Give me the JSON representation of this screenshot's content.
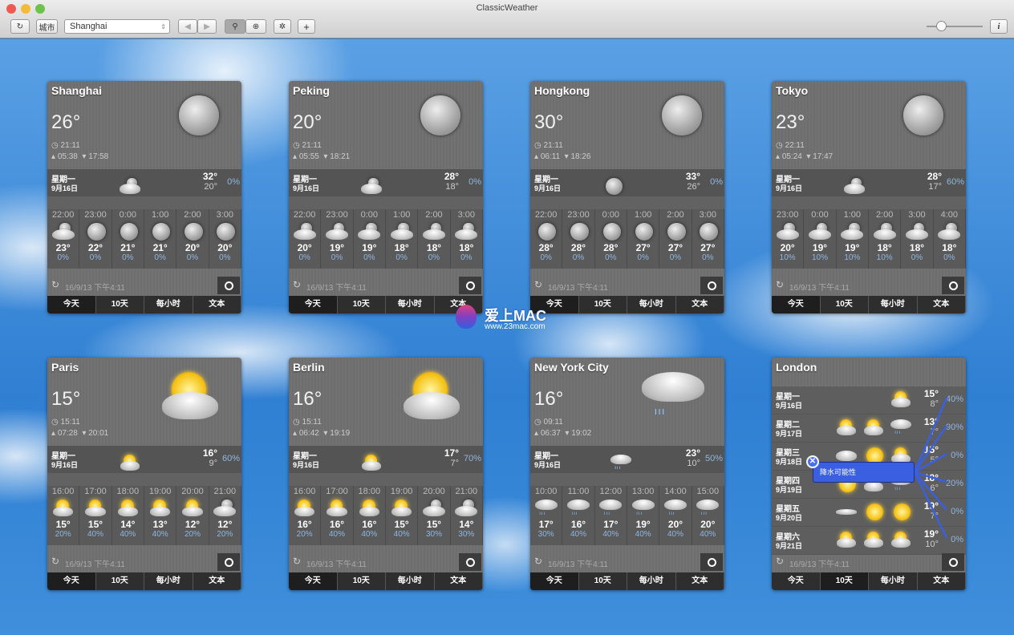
{
  "window": {
    "title": "ClassicWeather"
  },
  "toolbar": {
    "refresh_icon": "↻",
    "city_label": "城市",
    "city_value": "Shanghai",
    "prev": "◀",
    "next": "▶",
    "zoom_out": "⚲",
    "zoom_in": "⊕",
    "settings": "✲",
    "add": "+",
    "info": "i",
    "zoom_slider": 0.25
  },
  "tabs": [
    "今天",
    "10天",
    "每小时",
    "文本"
  ],
  "updated": "16/9/13 下午4:11",
  "cards": [
    {
      "name": "Shanghai",
      "temp": "26°",
      "time": "21:11",
      "sunrise": "05:38",
      "sunset": "17:58",
      "icon": "moon",
      "today": {
        "day": "星期一",
        "date": "9月16日",
        "icon": "cloud-moon",
        "hi": "32°",
        "lo": "20°",
        "precip": "0%"
      },
      "hours": [
        [
          "22:00",
          "cloud-moon",
          "23°",
          "0%"
        ],
        [
          "23:00",
          "moon",
          "22°",
          "0%"
        ],
        [
          "0:00",
          "moon",
          "21°",
          "0%"
        ],
        [
          "1:00",
          "moon",
          "21°",
          "0%"
        ],
        [
          "2:00",
          "moon",
          "20°",
          "0%"
        ],
        [
          "3:00",
          "moon",
          "20°",
          "0%"
        ]
      ]
    },
    {
      "name": "Peking",
      "temp": "20°",
      "time": "21:11",
      "sunrise": "05:55",
      "sunset": "18:21",
      "icon": "moon",
      "today": {
        "day": "星期一",
        "date": "9月16日",
        "icon": "cloud-moon",
        "hi": "28°",
        "lo": "18°",
        "precip": "0%"
      },
      "hours": [
        [
          "22:00",
          "cloud-moon",
          "20°",
          "0%"
        ],
        [
          "23:00",
          "cloud-moon",
          "19°",
          "0%"
        ],
        [
          "0:00",
          "cloud-moon",
          "19°",
          "0%"
        ],
        [
          "1:00",
          "cloud-moon",
          "18°",
          "0%"
        ],
        [
          "2:00",
          "cloud-moon",
          "18°",
          "0%"
        ],
        [
          "3:00",
          "cloud-moon",
          "18°",
          "0%"
        ]
      ]
    },
    {
      "name": "Hongkong",
      "temp": "30°",
      "time": "21:11",
      "sunrise": "06:11",
      "sunset": "18:26",
      "icon": "moon",
      "today": {
        "day": "星期一",
        "date": "9月16日",
        "icon": "moon",
        "hi": "33°",
        "lo": "26°",
        "precip": "0%"
      },
      "hours": [
        [
          "22:00",
          "moon",
          "28°",
          "0%"
        ],
        [
          "23:00",
          "moon",
          "28°",
          "0%"
        ],
        [
          "0:00",
          "moon",
          "28°",
          "0%"
        ],
        [
          "1:00",
          "moon",
          "27°",
          "0%"
        ],
        [
          "2:00",
          "moon",
          "27°",
          "0%"
        ],
        [
          "3:00",
          "moon",
          "27°",
          "0%"
        ]
      ]
    },
    {
      "name": "Tokyo",
      "temp": "23°",
      "time": "22:11",
      "sunrise": "05:24",
      "sunset": "17:47",
      "icon": "moon",
      "today": {
        "day": "星期一",
        "date": "9月16日",
        "icon": "cloud-moon",
        "hi": "28°",
        "lo": "17°",
        "precip": "60%"
      },
      "hours": [
        [
          "23:00",
          "cloud-moon",
          "20°",
          "10%"
        ],
        [
          "0:00",
          "cloud-moon",
          "19°",
          "10%"
        ],
        [
          "1:00",
          "cloud-moon",
          "19°",
          "10%"
        ],
        [
          "2:00",
          "cloud-moon",
          "18°",
          "10%"
        ],
        [
          "3:00",
          "cloud-moon",
          "18°",
          "0%"
        ],
        [
          "4:00",
          "cloud-moon",
          "18°",
          "0%"
        ]
      ]
    },
    {
      "name": "Paris",
      "temp": "15°",
      "time": "15:11",
      "sunrise": "07:28",
      "sunset": "20:01",
      "icon": "cloud-sun",
      "today": {
        "day": "星期一",
        "date": "9月16日",
        "icon": "cloud-sun",
        "hi": "16°",
        "lo": "9°",
        "precip": "60%"
      },
      "hours": [
        [
          "16:00",
          "cloud-sun",
          "15°",
          "20%"
        ],
        [
          "17:00",
          "cloud-sun",
          "15°",
          "40%"
        ],
        [
          "18:00",
          "cloud-sun",
          "14°",
          "40%"
        ],
        [
          "19:00",
          "cloud-sun",
          "13°",
          "40%"
        ],
        [
          "20:00",
          "cloud-sun",
          "12°",
          "20%"
        ],
        [
          "21:00",
          "cloud-moon",
          "12°",
          "20%"
        ]
      ]
    },
    {
      "name": "Berlin",
      "temp": "16°",
      "time": "15:11",
      "sunrise": "06:42",
      "sunset": "19:19",
      "icon": "cloud-sun",
      "today": {
        "day": "星期一",
        "date": "9月16日",
        "icon": "cloud-sun",
        "hi": "17°",
        "lo": "7°",
        "precip": "70%"
      },
      "hours": [
        [
          "16:00",
          "cloud-sun",
          "16°",
          "20%"
        ],
        [
          "17:00",
          "cloud-sun",
          "16°",
          "40%"
        ],
        [
          "18:00",
          "cloud-sun",
          "16°",
          "40%"
        ],
        [
          "19:00",
          "cloud-sun",
          "15°",
          "40%"
        ],
        [
          "20:00",
          "cloud-moon",
          "15°",
          "30%"
        ],
        [
          "21:00",
          "cloud-moon",
          "14°",
          "30%"
        ]
      ]
    },
    {
      "name": "New York City",
      "temp": "16°",
      "time": "09:11",
      "sunrise": "06:37",
      "sunset": "19:02",
      "icon": "rain",
      "today": {
        "day": "星期一",
        "date": "9月16日",
        "icon": "rain",
        "hi": "23°",
        "lo": "10°",
        "precip": "50%"
      },
      "hours": [
        [
          "10:00",
          "rain",
          "17°",
          "30%"
        ],
        [
          "11:00",
          "rain",
          "16°",
          "40%"
        ],
        [
          "12:00",
          "rain",
          "17°",
          "40%"
        ],
        [
          "13:00",
          "rain",
          "19°",
          "40%"
        ],
        [
          "14:00",
          "rain",
          "20°",
          "40%"
        ],
        [
          "15:00",
          "rain",
          "20°",
          "40%"
        ]
      ]
    }
  ],
  "london": {
    "name": "London",
    "tooltip": "降水可能性",
    "close": "✕",
    "days": [
      {
        "day": "星期一",
        "date": "9月16日",
        "icons": [
          "cloud-sun"
        ],
        "hi": "15°",
        "lo": "8°",
        "precip": "40%"
      },
      {
        "day": "星期二",
        "date": "9月17日",
        "icons": [
          "cloud-sun",
          "cloud-sun",
          "rain"
        ],
        "hi": "13°",
        "lo": "7°",
        "precip": "90%"
      },
      {
        "day": "星期三",
        "date": "9月18日",
        "icons": [
          "cloud",
          "sun",
          "cloud-sun"
        ],
        "hi": "15°",
        "lo": "5°",
        "precip": "0%"
      },
      {
        "day": "星期四",
        "date": "9月19日",
        "icons": [
          "sun",
          "cloud-sun",
          "rain"
        ],
        "hi": "18°",
        "lo": "6°",
        "precip": "20%"
      },
      {
        "day": "星期五",
        "date": "9月20日",
        "icons": [
          "fog",
          "sun",
          "sun"
        ],
        "hi": "19°",
        "lo": "7°",
        "precip": "0%"
      },
      {
        "day": "星期六",
        "date": "9月21日",
        "icons": [
          "cloud-sun",
          "cloud-sun",
          "cloud-sun"
        ],
        "hi": "19°",
        "lo": "10°",
        "precip": "0%"
      }
    ]
  },
  "watermark": {
    "title": "爱上MAC",
    "url": "www.23mac.com"
  }
}
